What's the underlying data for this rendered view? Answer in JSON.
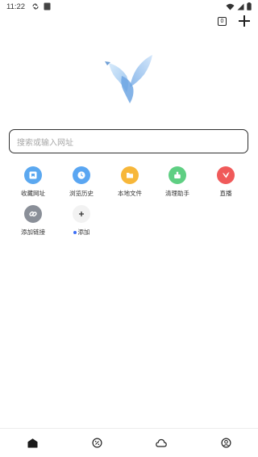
{
  "status_bar": {
    "time": "11:22"
  },
  "toolbar": {
    "tab_count": "0"
  },
  "search": {
    "placeholder": "搜索或输入网址"
  },
  "shortcuts": [
    {
      "label": "收藏网址",
      "color": "#5ba8f0",
      "icon": "bookmark-icon"
    },
    {
      "label": "浏览历史",
      "color": "#5aa6f2",
      "icon": "clock-icon"
    },
    {
      "label": "本地文件",
      "color": "#f7b73a",
      "icon": "folder-icon"
    },
    {
      "label": "清理助手",
      "color": "#5fcf83",
      "icon": "broom-icon"
    },
    {
      "label": "直播",
      "color": "#f05a5a",
      "icon": "bird-icon"
    },
    {
      "label": "添加链接",
      "color": "#8a8f98",
      "icon": "link-icon"
    },
    {
      "label": "添加",
      "color": "#f2f2f2",
      "icon": "plus-icon"
    }
  ],
  "accent_color": "#3b6ef5"
}
